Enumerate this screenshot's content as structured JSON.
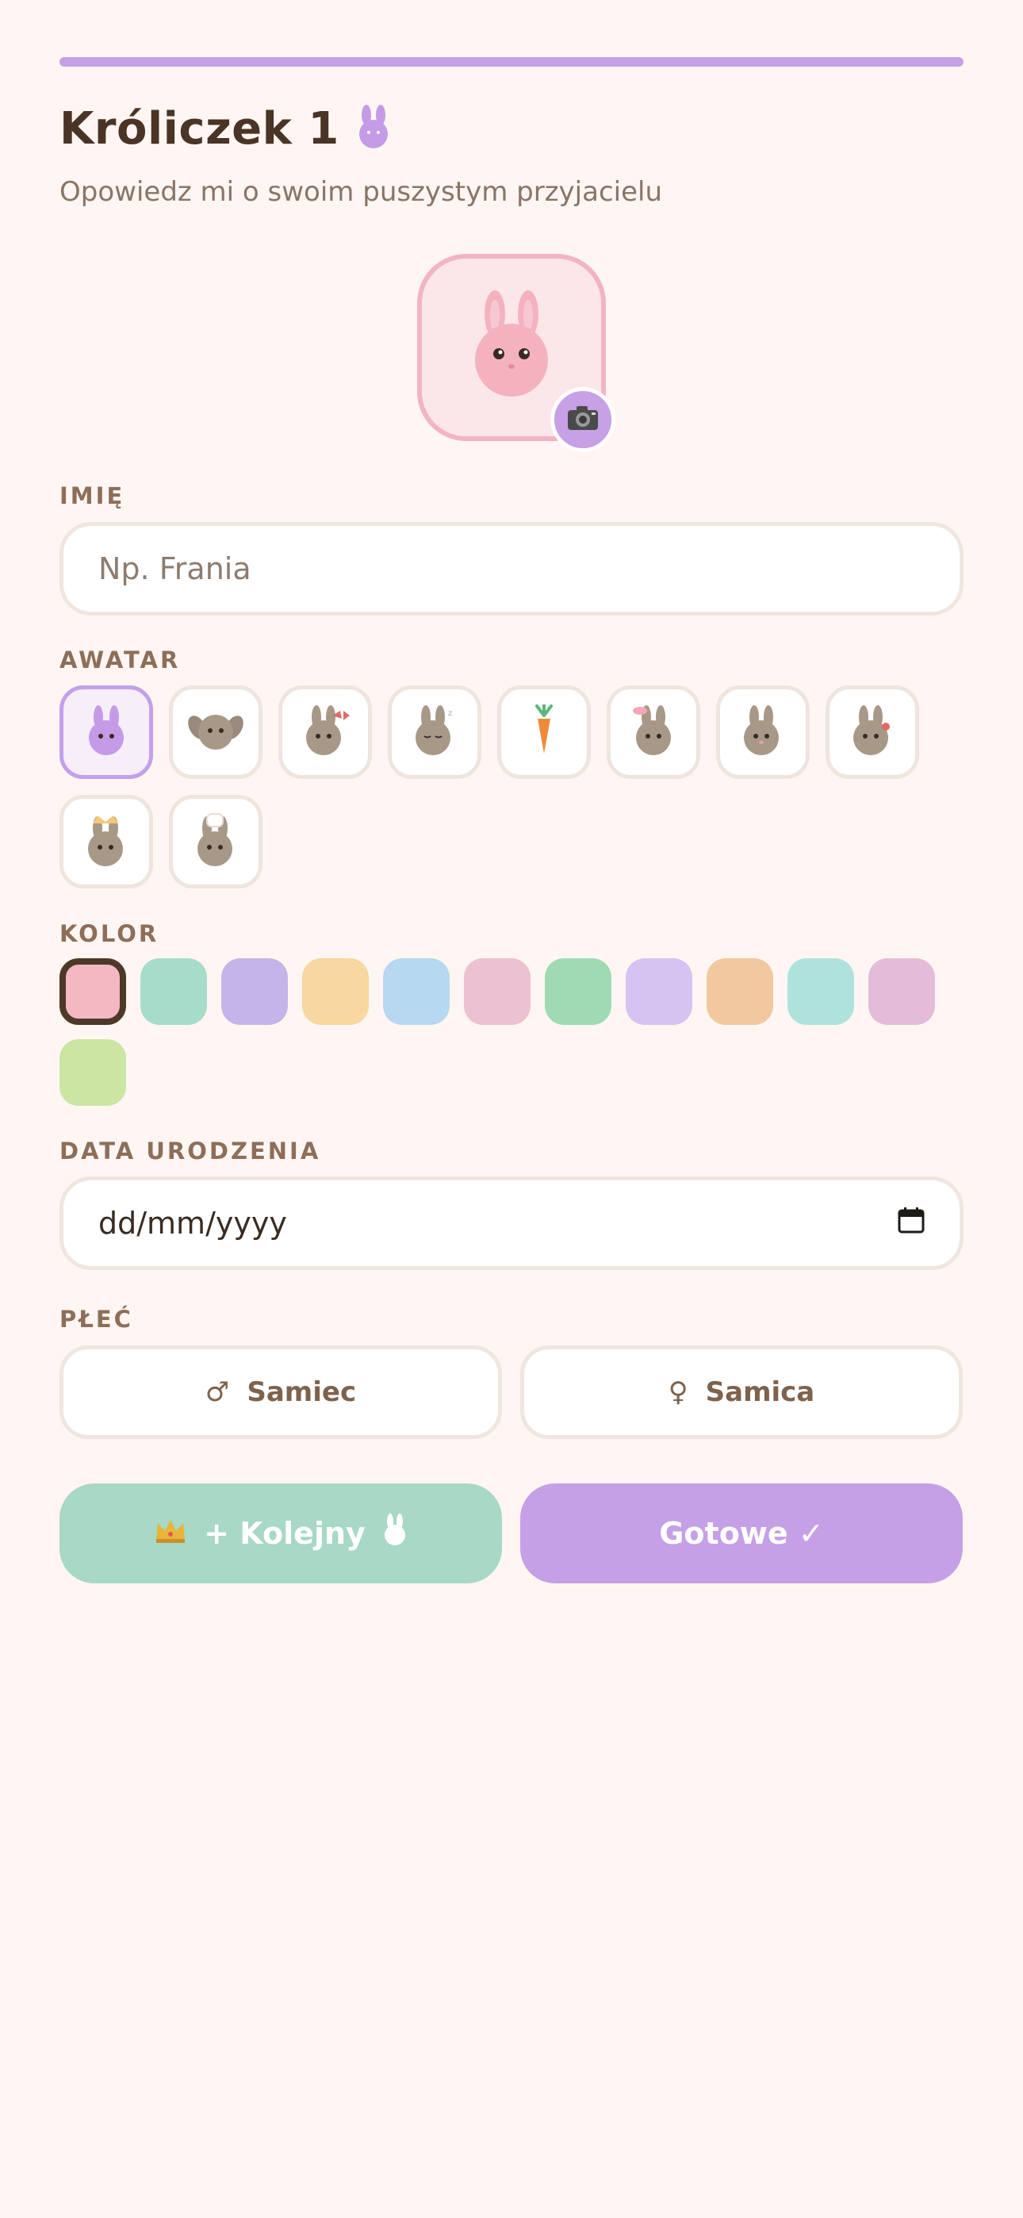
{
  "progress": {
    "value": 1.0,
    "color": "#c5a0e6"
  },
  "header": {
    "title": "Króliczek 1",
    "subtitle": "Opowiedz mi o swoim puszystym przyjacielu",
    "title_icon": "bunny-icon"
  },
  "avatar_preview": {
    "icon": "bunny-face-icon",
    "badge_icon": "camera-icon"
  },
  "name_field": {
    "label": "IMIĘ",
    "placeholder": "Np. Frania",
    "value": ""
  },
  "avatar_picker": {
    "label": "AWATAR",
    "options": [
      "purple-bunny-icon",
      "lop-bunny-icon",
      "bunny-with-bow-icon",
      "sleepy-bunny-icon",
      "carrot-icon",
      "bunny-with-flower-icon",
      "blushing-bunny-icon",
      "bunny-with-heart-icon",
      "bunny-with-crown-icon",
      "bunny-with-chef-hat-icon"
    ],
    "selected_index": 0
  },
  "color_picker": {
    "label": "KOLOR",
    "colors": [
      "#f4b8c2",
      "#a6dcc9",
      "#c5b4e9",
      "#f8d7a0",
      "#b6d8f0",
      "#ecc1d1",
      "#a0dab4",
      "#d6c3f2",
      "#f2c99f",
      "#b0e2dd",
      "#e4bcd8",
      "#cbe5a2"
    ],
    "selected_index": 0
  },
  "birth_date": {
    "label": "DATA URODZENIA",
    "value": "dd/mm/yyyy",
    "icon": "calendar-icon"
  },
  "gender": {
    "label": "PŁEĆ",
    "male": {
      "symbol": "♂",
      "label": "Samiec"
    },
    "female": {
      "symbol": "♀",
      "label": "Samica"
    }
  },
  "actions": {
    "next": {
      "label": "+ Kolejny",
      "icon": "crown-icon",
      "trail_icon": "bunny-icon",
      "color": "#a8d8c6"
    },
    "done": {
      "label": "Gotowe ✓",
      "color": "#c5a0e6"
    }
  }
}
